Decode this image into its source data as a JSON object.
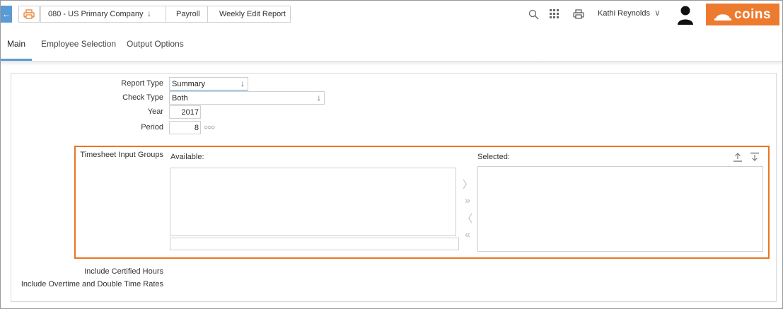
{
  "header": {
    "company": "080 - US Primary Company",
    "module": "Payroll",
    "report": "Weekly Edit Report",
    "user": "Kathi Reynolds",
    "brand": "coins"
  },
  "tabs": [
    {
      "label": "Main"
    },
    {
      "label": "Employee Selection"
    },
    {
      "label": "Output Options"
    }
  ],
  "form": {
    "report_type_label": "Report Type",
    "report_type_value": "Summary",
    "check_type_label": "Check Type",
    "check_type_value": "Both",
    "year_label": "Year",
    "year_value": "2017",
    "period_label": "Period",
    "period_value": "8",
    "groups_label": "Timesheet Input Groups",
    "available_label": "Available:",
    "selected_label": "Selected:",
    "certified_label": "Include Certified Hours",
    "overtime_label": "Include Overtime and Double Time Rates"
  },
  "colors": {
    "accent": "#5b9bd5",
    "brand": "#ec7a2f",
    "highlight": "#e87722"
  }
}
